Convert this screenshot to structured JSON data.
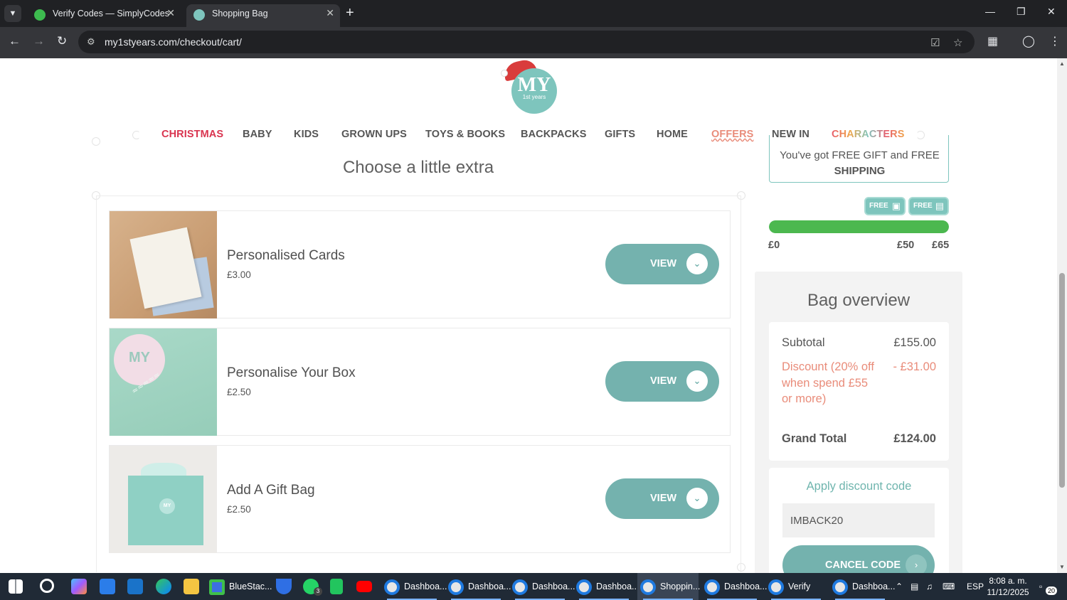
{
  "browser": {
    "tabs": [
      {
        "title": "Verify Codes — SimplyCodes",
        "active": false
      },
      {
        "title": "Shopping Bag",
        "active": true
      }
    ],
    "url": "my1styears.com/checkout/cart/"
  },
  "site": {
    "logo_text": "MY",
    "logo_sub": "1st years",
    "nav": [
      "CHRISTMAS",
      "BABY",
      "KIDS",
      "GROWN UPS",
      "TOYS & BOOKS",
      "BACKPACKS",
      "GIFTS",
      "HOME",
      "OFFERS",
      "NEW IN",
      "CHARACTERS"
    ],
    "colors": {
      "accent": "#74b2ae",
      "christmas": "#d9344f",
      "offers": "#e98c7a",
      "discount": "#e98c7a",
      "progress": "#4cb84f"
    }
  },
  "extras": {
    "title": "Choose a little extra",
    "view_label": "VIEW",
    "items": [
      {
        "name": "Personalised Cards",
        "price": "£3.00"
      },
      {
        "name": "Personalise Your Box",
        "price": "£2.50"
      },
      {
        "name": "Add A Gift Bag",
        "price": "£2.50"
      }
    ]
  },
  "shipping": {
    "message_line1": "You've got FREE GIFT and FREE",
    "message_line2": "SHIPPING",
    "badges": [
      {
        "label": "FREE",
        "icon": "truck-icon"
      },
      {
        "label": "FREE",
        "icon": "gift-box-icon"
      }
    ],
    "progress_fraction": 1.0,
    "progress_labels": [
      "£0",
      "£50",
      "£65"
    ]
  },
  "overview": {
    "title": "Bag overview",
    "subtotal_label": "Subtotal",
    "subtotal_value": "£155.00",
    "discount_label": "Discount (20% off when spend £55 or more)",
    "discount_value": "- £31.00",
    "grand_total_label": "Grand Total",
    "grand_total_value": "£124.00",
    "discount_code_title": "Apply discount code",
    "discount_code_value": "IMBACK20",
    "cancel_label": "CANCEL CODE"
  },
  "taskbar": {
    "apps": [
      {
        "label": "BlueStac..."
      },
      {
        "label": "Dashboa..."
      },
      {
        "label": "Dashboa..."
      },
      {
        "label": "Dashboa..."
      },
      {
        "label": "Dashboa..."
      },
      {
        "label": "Shoppin..."
      },
      {
        "label": "Dashboa..."
      },
      {
        "label": "Verify C..."
      },
      {
        "label": "Dashboa..."
      }
    ],
    "whatsapp_badge": "3",
    "language": "ESP",
    "time": "8:08 a. m.",
    "date": "11/12/2025",
    "notifications": "20"
  }
}
